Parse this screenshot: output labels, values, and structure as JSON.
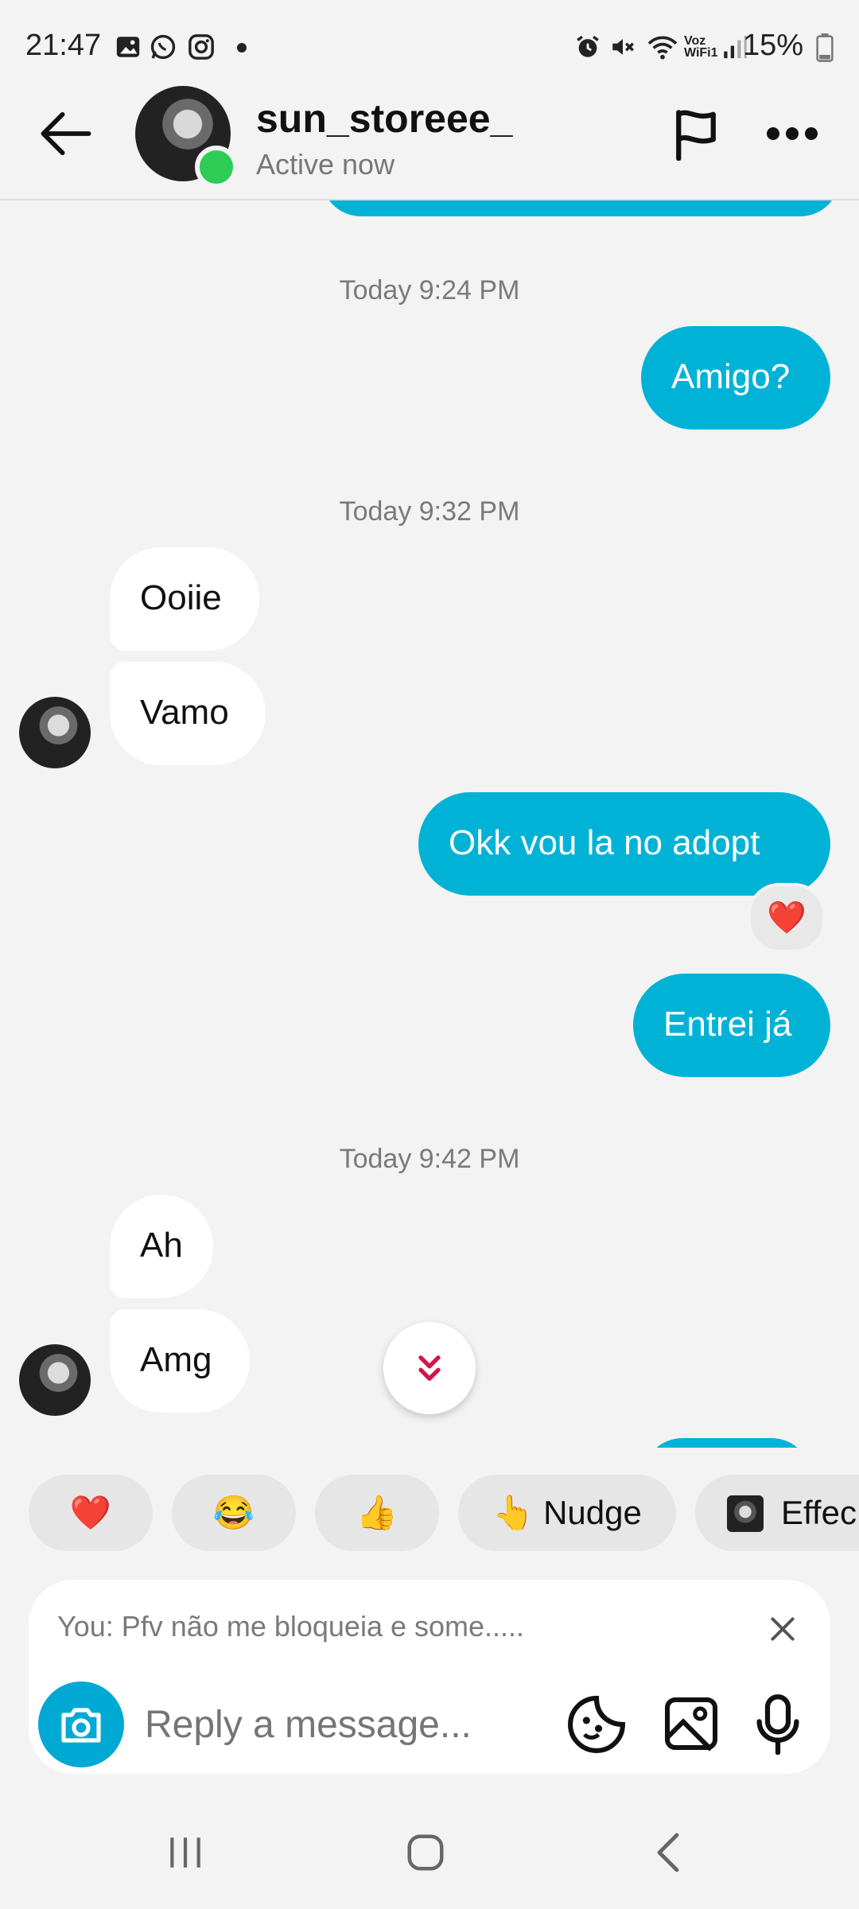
{
  "status_bar": {
    "time": "21:47",
    "battery": "15%",
    "network_label": "Voz\nWiFi1",
    "icons": [
      "gallery-icon",
      "whatsapp-icon",
      "instagram-icon",
      "dot-icon",
      "alarm-icon",
      "mute-icon",
      "wifi-icon",
      "signal-icon",
      "battery-icon"
    ]
  },
  "header": {
    "username": "sun_storeee_",
    "status": "Active now",
    "icons": [
      "back-arrow-icon",
      "flag-icon",
      "more-icon"
    ]
  },
  "chat": {
    "groups": [
      {
        "timestamp": "Today 9:24 PM"
      },
      {
        "timestamp": "Today 9:32 PM"
      },
      {
        "timestamp": "Today 9:42 PM"
      }
    ],
    "messages": [
      {
        "side": "out",
        "text": "Amigo?"
      },
      {
        "side": "in",
        "text": "Ooiie"
      },
      {
        "side": "in",
        "text": "Vamo"
      },
      {
        "side": "out",
        "text": "Okk vou la no adopt",
        "reaction": "❤️"
      },
      {
        "side": "out",
        "text": "Entrei já"
      },
      {
        "side": "in",
        "text": "Ah"
      },
      {
        "side": "in",
        "text": "Amg"
      }
    ]
  },
  "quick_reactions": [
    {
      "emoji": "❤️",
      "label": ""
    },
    {
      "emoji": "😂",
      "label": ""
    },
    {
      "emoji": "👍",
      "label": ""
    },
    {
      "emoji": "👆",
      "label": "Nudge"
    },
    {
      "emoji": "",
      "label": "Effec"
    }
  ],
  "composer": {
    "reply_preview": "You: Pfv não me bloqueia e some.....",
    "placeholder": "Reply a message...",
    "icons": [
      "camera-icon",
      "sticker-icon",
      "gallery-icon",
      "microphone-icon",
      "close-icon"
    ]
  },
  "colors": {
    "outgoing_bubble": "#00b3d6",
    "incoming_bubble": "#ffffff",
    "online_dot": "#2ecc55",
    "accent_red": "#e8182c"
  }
}
